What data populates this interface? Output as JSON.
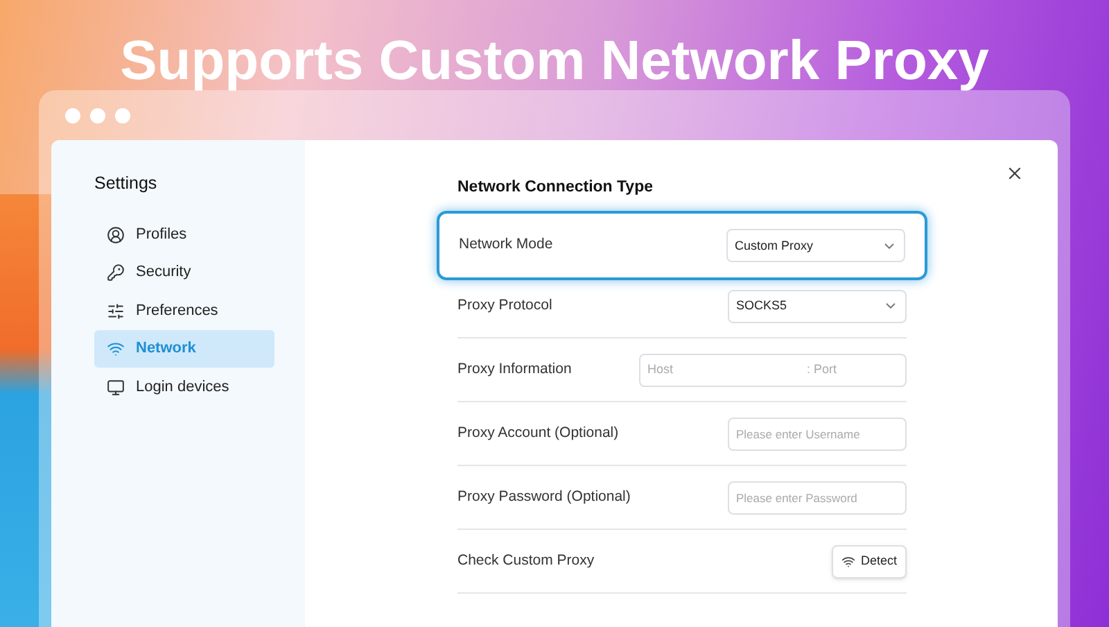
{
  "headline": "Supports Custom Network Proxy",
  "sidebar": {
    "title": "Settings",
    "items": [
      {
        "label": "Profiles",
        "selected": false
      },
      {
        "label": "Security",
        "selected": false
      },
      {
        "label": "Preferences",
        "selected": false
      },
      {
        "label": "Network",
        "selected": true
      },
      {
        "label": "Login devices",
        "selected": false
      }
    ]
  },
  "section_title": "Network Connection Type",
  "rows": [
    {
      "kind": "select",
      "label": "Network Mode",
      "value": "Custom Proxy",
      "highlighted": true
    },
    {
      "kind": "select",
      "label": "Proxy Protocol",
      "value": "SOCKS5",
      "highlighted": false
    },
    {
      "kind": "hostport",
      "label": "Proxy Information",
      "host_placeholder": "Host",
      "separator": ":",
      "port_placeholder": "Port",
      "highlighted": false
    },
    {
      "kind": "input",
      "label": "Proxy Account (Optional)",
      "placeholder": "Please enter Username",
      "highlighted": false
    },
    {
      "kind": "input",
      "label": "Proxy Password (Optional)",
      "placeholder": "Please enter Password",
      "highlighted": false
    },
    {
      "kind": "button",
      "label": "Check Custom Proxy",
      "button": "Detect",
      "highlighted": false
    }
  ]
}
